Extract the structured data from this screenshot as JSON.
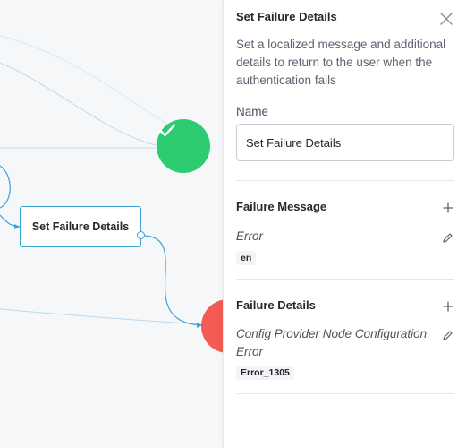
{
  "canvas": {
    "node_label": "Set Failure Details"
  },
  "panel": {
    "title": "Set Failure Details",
    "description": "Set a localized message and additional details to return to the user when the authentication fails",
    "name_label": "Name",
    "name_value": "Set Failure Details",
    "failure_message": {
      "title": "Failure Message",
      "text": "Error",
      "locale": "en"
    },
    "failure_details": {
      "title": "Failure Details",
      "text": "Config Provider Node Configuration Error",
      "code": "Error_1305"
    }
  },
  "colors": {
    "accent": "#3aa3d6",
    "success": "#2ecc71",
    "failure": "#f25c54"
  },
  "icons": [
    "checkmark-icon",
    "close-icon",
    "plus-icon",
    "pencil-icon"
  ]
}
